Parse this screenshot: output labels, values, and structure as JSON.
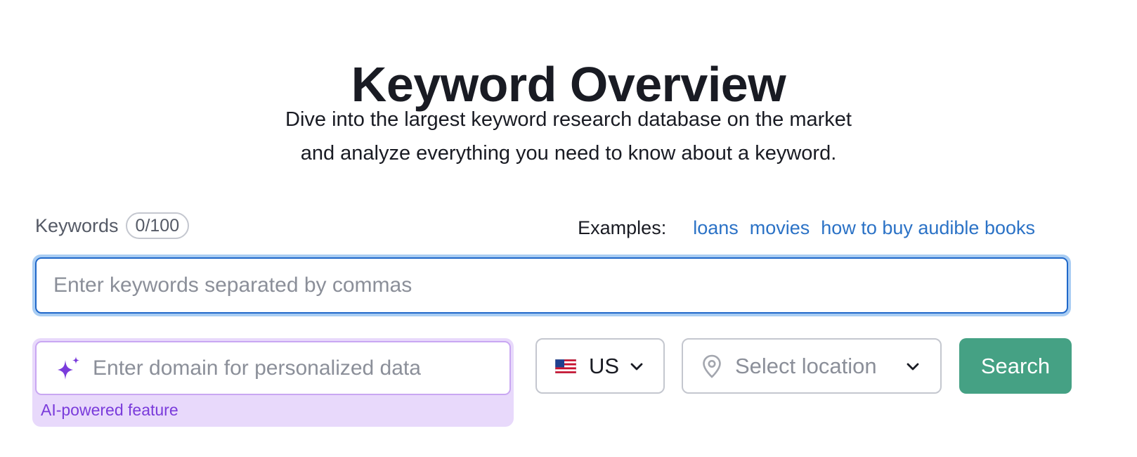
{
  "header": {
    "title": "Keyword Overview",
    "subtitle_line1": "Dive into the largest keyword research database on the market",
    "subtitle_line2": "and analyze everything you need to know about a keyword."
  },
  "keywords": {
    "label": "Keywords",
    "counter": "0/100",
    "placeholder": "Enter keywords separated by commas",
    "value": ""
  },
  "examples": {
    "label": "Examples:",
    "links": [
      "loans",
      "movies",
      "how to buy audible books"
    ]
  },
  "domain": {
    "placeholder": "Enter domain for personalized data",
    "caption": "AI-powered feature",
    "icon": "sparkle-icon"
  },
  "country": {
    "value": "US",
    "flag": "us-flag-icon"
  },
  "location": {
    "placeholder": "Select location",
    "icon": "location-pin-icon"
  },
  "search": {
    "label": "Search"
  },
  "colors": {
    "accent_blue": "#2b72c6",
    "search_green": "#45a184",
    "ai_purple": "#7a3bdb",
    "ai_bg": "#e8d9fb"
  }
}
